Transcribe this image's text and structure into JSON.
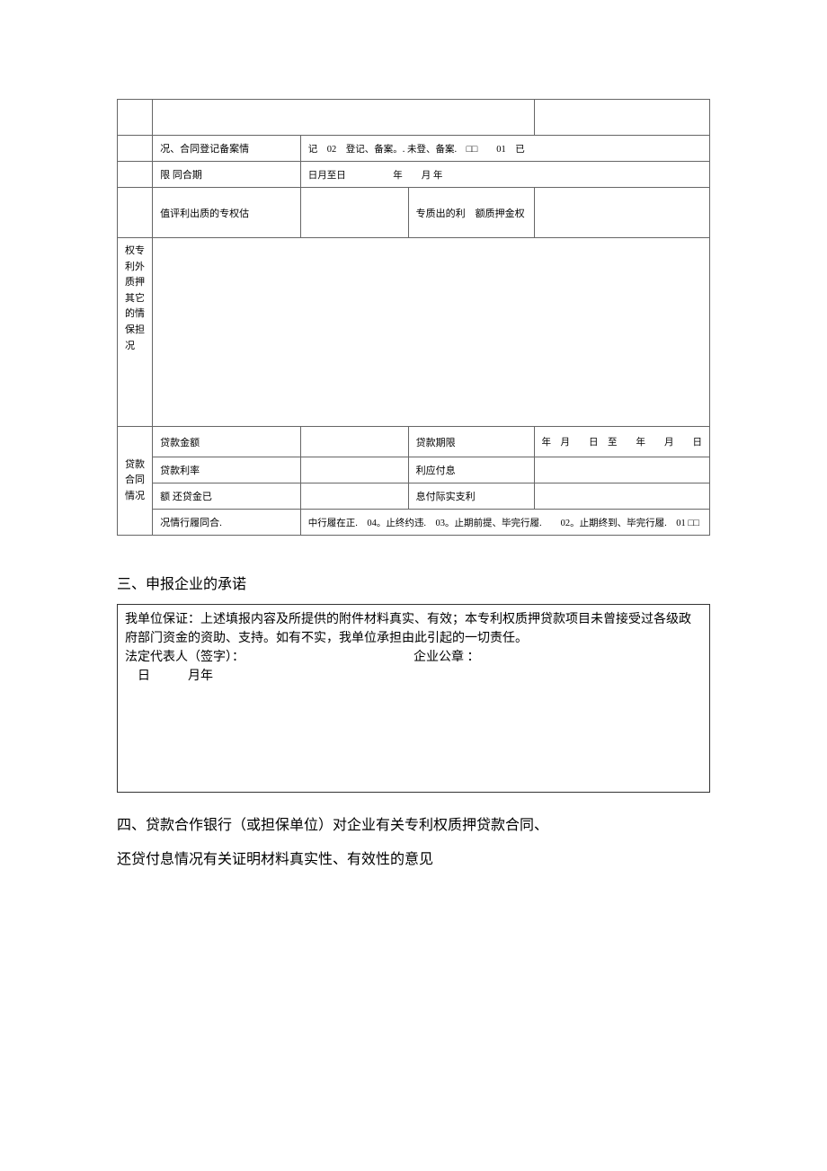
{
  "table": {
    "row_reg_status": {
      "label": "况、合同登记备案情",
      "value": "记　02　登记、备案。. 未登、备案.　□□　　01　已"
    },
    "row_contract_period": {
      "label": "限 同合期",
      "value": "日月至日　　　　　年　　月 年"
    },
    "row_patent_value": {
      "left_label": "值评利出质的专权估",
      "right_label": "专质出的利　额质押金权"
    },
    "row_other_guarantee": {
      "label": "权专利外质押其它的情保担况"
    },
    "row_loan_section_label": "贷款合同情况",
    "row_loan_amount": {
      "label": "贷款金额",
      "label2": "贷款期限",
      "value2": "年　月　　日　至　　年　　月　　日"
    },
    "row_loan_rate": {
      "label": "贷款利率",
      "label2": "利应付息"
    },
    "row_repaid": {
      "label": "额 还贷金已",
      "label2": "息付际实支利"
    },
    "row_perf_status": {
      "label": "况情行履同合.",
      "value": "中行履在正.　04。止终约违.　03。止期前提、毕完行履.　　02。止期终到、毕完行履.　01 □□"
    }
  },
  "section3": {
    "heading": "三、申报企业的承诺",
    "body1": "我单位保证：上述填报内容及所提供的附件材料真实、有效；本专利权质押贷款项目未曾接受过各级政府部门资金的资助、支持。如有不实，我单位承担由此引起的一切责任。",
    "sig_left": "法定代表人（签字）：",
    "sig_right": "企业公章 ：",
    "date": "　日　　　月年"
  },
  "section4": {
    "heading": "四、贷款合作银行（或担保单位）对企业有关专利权质押贷款合同、",
    "heading_line2": "还贷付息情况有关证明材料真实性、有效性的意见"
  }
}
